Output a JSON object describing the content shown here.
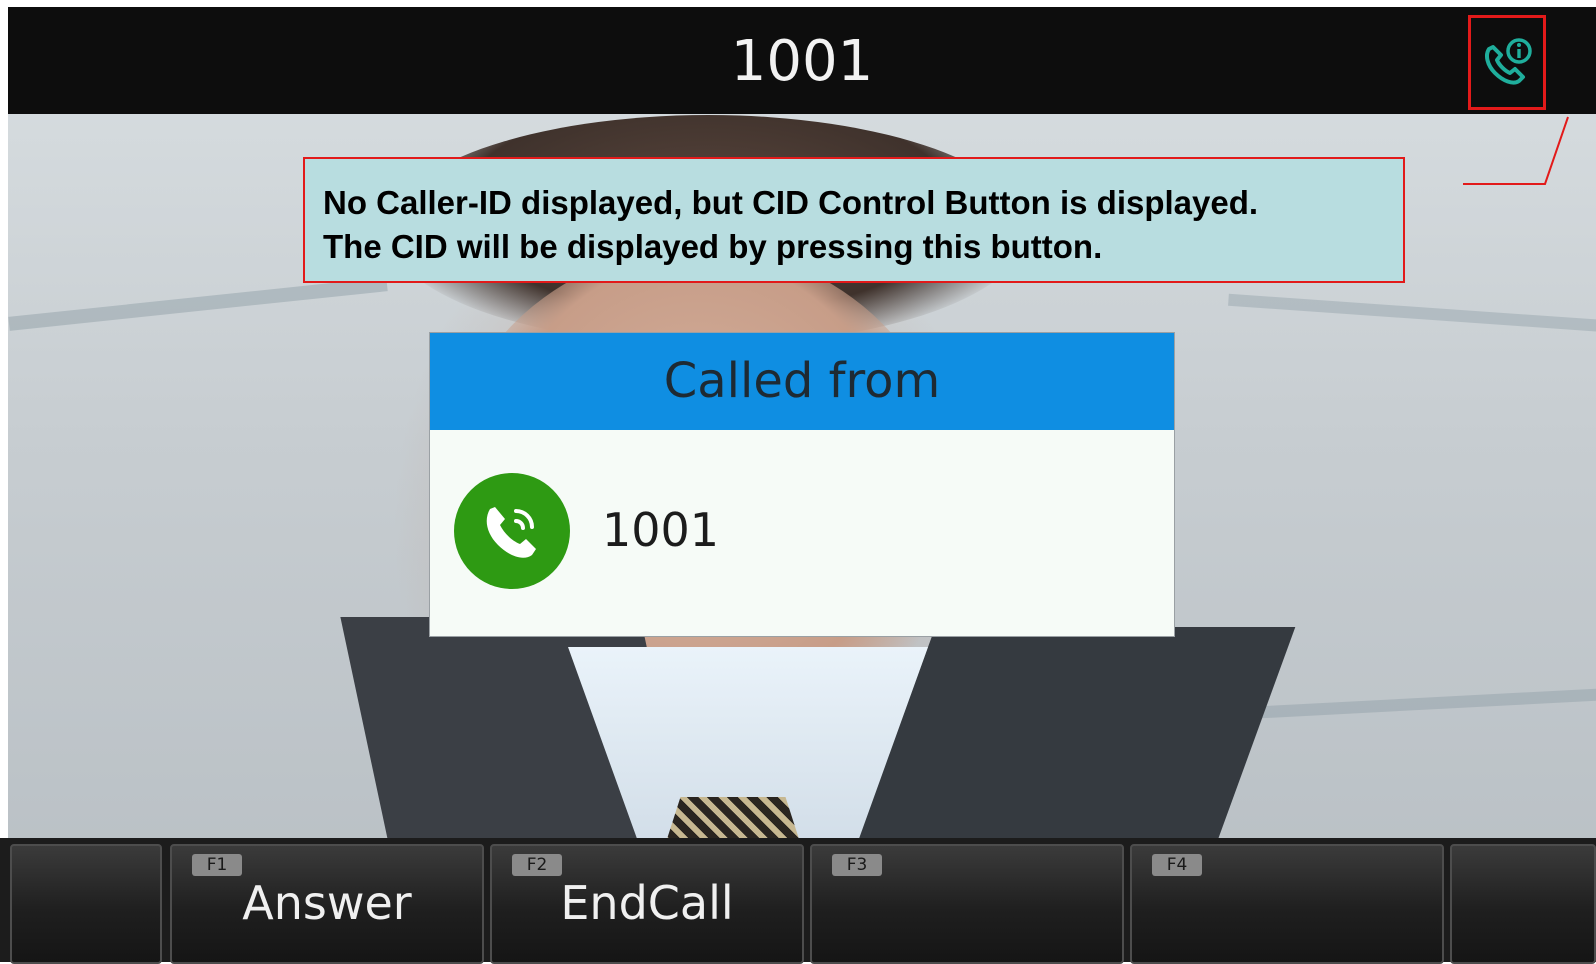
{
  "header": {
    "title": "1001",
    "cid_button_icon": "phone-info-icon"
  },
  "annotation": {
    "line1": "No Caller-ID displayed, but CID Control Button is displayed.",
    "line2": "The CID will be displayed by pressing this button."
  },
  "dialog": {
    "title": "Called from",
    "caller_icon": "phone-ringing-icon",
    "caller_number": "1001"
  },
  "softkeys": [
    {
      "key": "F1",
      "label": "Answer"
    },
    {
      "key": "F2",
      "label": "EndCall"
    },
    {
      "key": "F3",
      "label": ""
    },
    {
      "key": "F4",
      "label": ""
    }
  ],
  "colors": {
    "header_bg": "#0d0d0d",
    "dialog_header": "#0f8ee2",
    "caller_icon_bg": "#2e9a13",
    "annotation_bg": "#b8dde0",
    "annotation_border": "#e21a1a",
    "cid_icon": "#1fae9c"
  }
}
